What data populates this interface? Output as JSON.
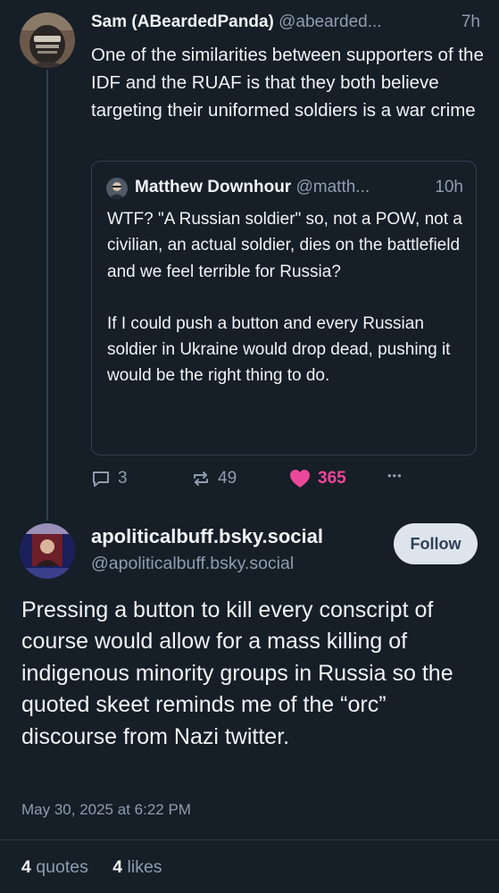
{
  "parent_post": {
    "display_name": "Sam (ABeardedPanda)",
    "handle": "@abearded...",
    "time": "7h",
    "text": "One of the similarities between supporters of the IDF and the RUAF is that they both believe targeting their uniformed soldiers is a war crime",
    "quote": {
      "display_name": "Matthew Downhour",
      "handle": "@matth...",
      "time": "10h",
      "paragraph1": "WTF? \"A Russian soldier\" so, not a POW, not a civilian, an actual soldier, dies on the battlefield and we feel terrible for Russia?",
      "paragraph2": "If I could push a button and every Russian soldier in Ukraine would drop dead, pushing it would be the right thing to do."
    },
    "actions": {
      "replies": "3",
      "reposts": "49",
      "likes": "365",
      "more": "•••"
    }
  },
  "reply": {
    "display_name": "apoliticalbuff.bsky.social",
    "handle": "@apoliticalbuff.bsky.social",
    "follow_label": "Follow",
    "text": "Pressing a button to kill every conscript of course would allow for a mass killing of indigenous minority groups in Russia so the quoted skeet reminds me of the “orc” discourse from Nazi twitter.",
    "date": "May 30, 2025 at 6:22 PM",
    "quotes_count": "4",
    "quotes_label": "quotes",
    "likes_count": "4",
    "likes_label": "likes"
  },
  "colors": {
    "background": "#161e27",
    "text": "#f1f3f5",
    "muted": "#8d9db0",
    "like": "#ec4899",
    "border": "#2e4052"
  },
  "icons": {
    "reply": "speech-bubble-icon",
    "repost": "repost-arrows-icon",
    "like": "heart-icon",
    "more": "ellipsis-icon"
  }
}
